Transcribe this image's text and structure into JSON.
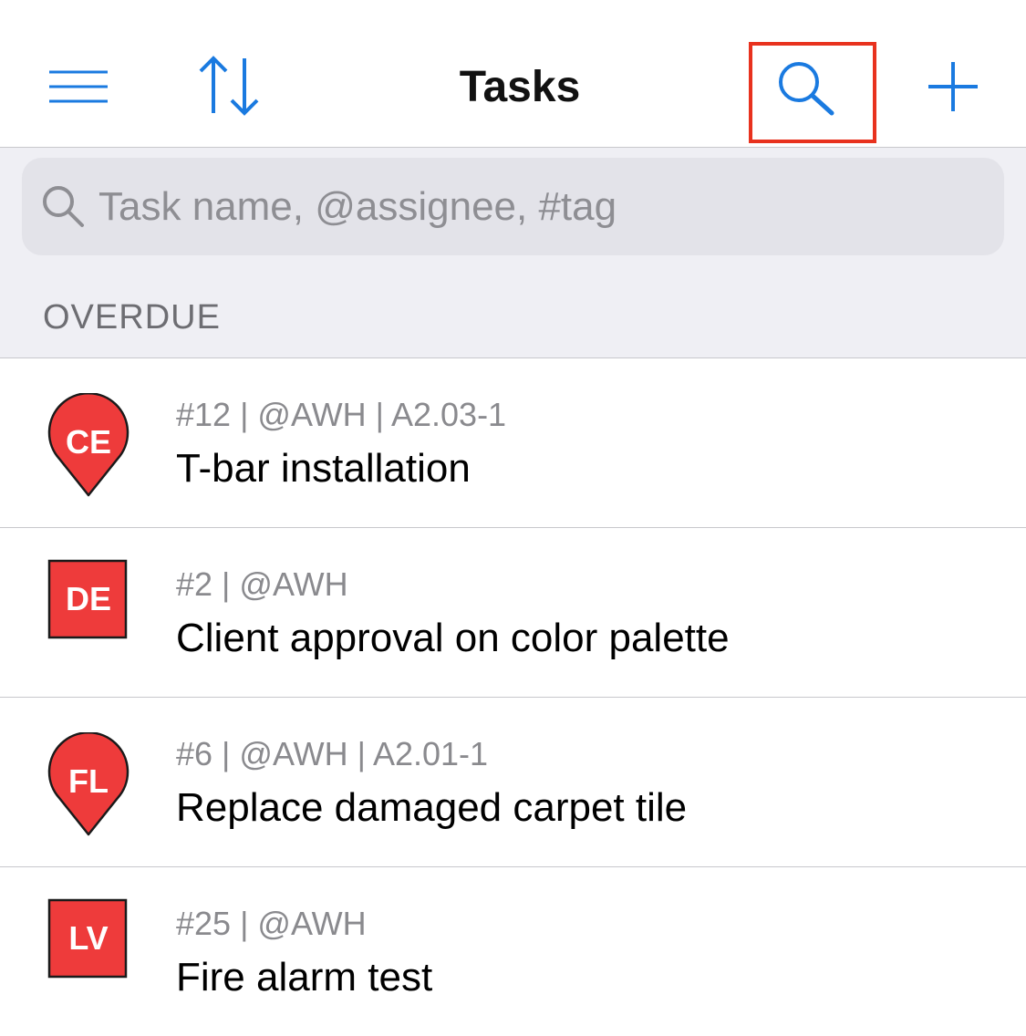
{
  "nav": {
    "title": "Tasks",
    "menu_icon": "hamburger-menu-icon",
    "sort_icon": "sort-arrows-icon",
    "search_icon": "search-icon",
    "add_icon": "plus-icon"
  },
  "colors": {
    "accent": "#1a7ae0",
    "highlight": "#e8321e",
    "marker_red": "#ee3b3b"
  },
  "search": {
    "placeholder": "Task name, @assignee, #tag",
    "value": ""
  },
  "section": {
    "title": "OVERDUE"
  },
  "tasks": [
    {
      "marker_shape": "pin",
      "marker_label": "CE",
      "meta": "#12 | @AWH | A2.03-1",
      "name": "T-bar installation"
    },
    {
      "marker_shape": "square",
      "marker_label": "DE",
      "meta": "#2 | @AWH",
      "name": "Client approval on color palette"
    },
    {
      "marker_shape": "pin",
      "marker_label": "FL",
      "meta": "#6 | @AWH | A2.01-1",
      "name": "Replace damaged carpet tile"
    },
    {
      "marker_shape": "square",
      "marker_label": "LV",
      "meta": "#25 | @AWH",
      "name": "Fire alarm test"
    }
  ]
}
